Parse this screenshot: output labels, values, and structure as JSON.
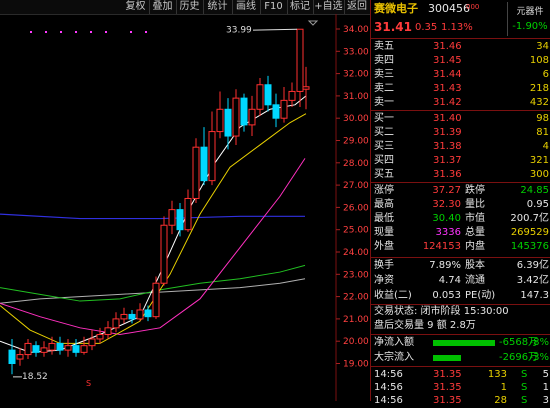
{
  "toolbar": {
    "items": [
      "复权",
      "叠加",
      "历史",
      "统计",
      "画线",
      "F10",
      "标记",
      "+自选",
      "返回"
    ]
  },
  "chart": {
    "price_axis_labels": [
      "34.00",
      "33.00",
      "32.00",
      "31.00",
      "30.00",
      "29.00",
      "28.00",
      "27.00",
      "26.00",
      "25.00",
      "24.00",
      "23.00",
      "22.00",
      "21.00",
      "20.00",
      "19.00"
    ],
    "high_label": "33.99",
    "low_label": "18.52",
    "signal_marker": "S"
  },
  "quote": {
    "name": "赛微电子",
    "code": "300456",
    "code_suffix": "000",
    "price": "31.41",
    "change": "0.35",
    "change_pct": "1.13%",
    "sector": "元器件",
    "sector_pct": "-1.90%"
  },
  "order_book": {
    "asks": [
      {
        "label": "卖五",
        "price": "31.46",
        "vol": "34"
      },
      {
        "label": "卖四",
        "price": "31.45",
        "vol": "108"
      },
      {
        "label": "卖三",
        "price": "31.44",
        "vol": "6"
      },
      {
        "label": "卖二",
        "price": "31.43",
        "vol": "218"
      },
      {
        "label": "卖一",
        "price": "31.42",
        "vol": "432"
      }
    ],
    "bids": [
      {
        "label": "买一",
        "price": "31.40",
        "vol": "98"
      },
      {
        "label": "买二",
        "price": "31.39",
        "vol": "81"
      },
      {
        "label": "买三",
        "price": "31.38",
        "vol": "4"
      },
      {
        "label": "买四",
        "price": "31.37",
        "vol": "321"
      },
      {
        "label": "买五",
        "price": "31.36",
        "vol": "300"
      }
    ]
  },
  "stats": [
    {
      "l1": "涨停",
      "v1": "37.27",
      "l2": "跌停",
      "v2": "24.85"
    },
    {
      "l1": "最高",
      "v1": "32.30",
      "l2": "量比",
      "v2": "0.95"
    },
    {
      "l1": "最低",
      "v1": "30.40",
      "l2": "市值",
      "v2": "200.7亿"
    },
    {
      "l1": "现量",
      "v1": "3336",
      "l2": "总量",
      "v2": "269529"
    },
    {
      "l1": "外盘",
      "v1": "124153",
      "l2": "内盘",
      "v2": "145376"
    },
    {
      "l1": "换手",
      "v1": "7.89%",
      "l2": "股本",
      "v2": "6.39亿"
    },
    {
      "l1": "净资",
      "v1": "4.74",
      "l2": "流通",
      "v2": "3.42亿"
    },
    {
      "l1": "收益(二)",
      "v1": "0.053",
      "l2": "PE(动)",
      "v2": "147.3"
    }
  ],
  "status": {
    "trade_status": "交易状态: 闭市阶段 15:30:00",
    "after_hours": "盘后交易量 9  额 2.8万"
  },
  "flow": [
    {
      "label": "净流入额",
      "value": "-6568万",
      "pct": "-8%"
    },
    {
      "label": "大宗流入",
      "value": "-2696万",
      "pct": "-3%"
    }
  ],
  "ticks": [
    {
      "time": "14:56",
      "price": "31.35",
      "vol": "133",
      "dir": "S",
      "n": "5"
    },
    {
      "time": "14:56",
      "price": "31.35",
      "vol": "1",
      "dir": "S",
      "n": "1"
    },
    {
      "time": "14:56",
      "price": "31.35",
      "vol": "28",
      "dir": "S",
      "n": "3"
    }
  ]
}
